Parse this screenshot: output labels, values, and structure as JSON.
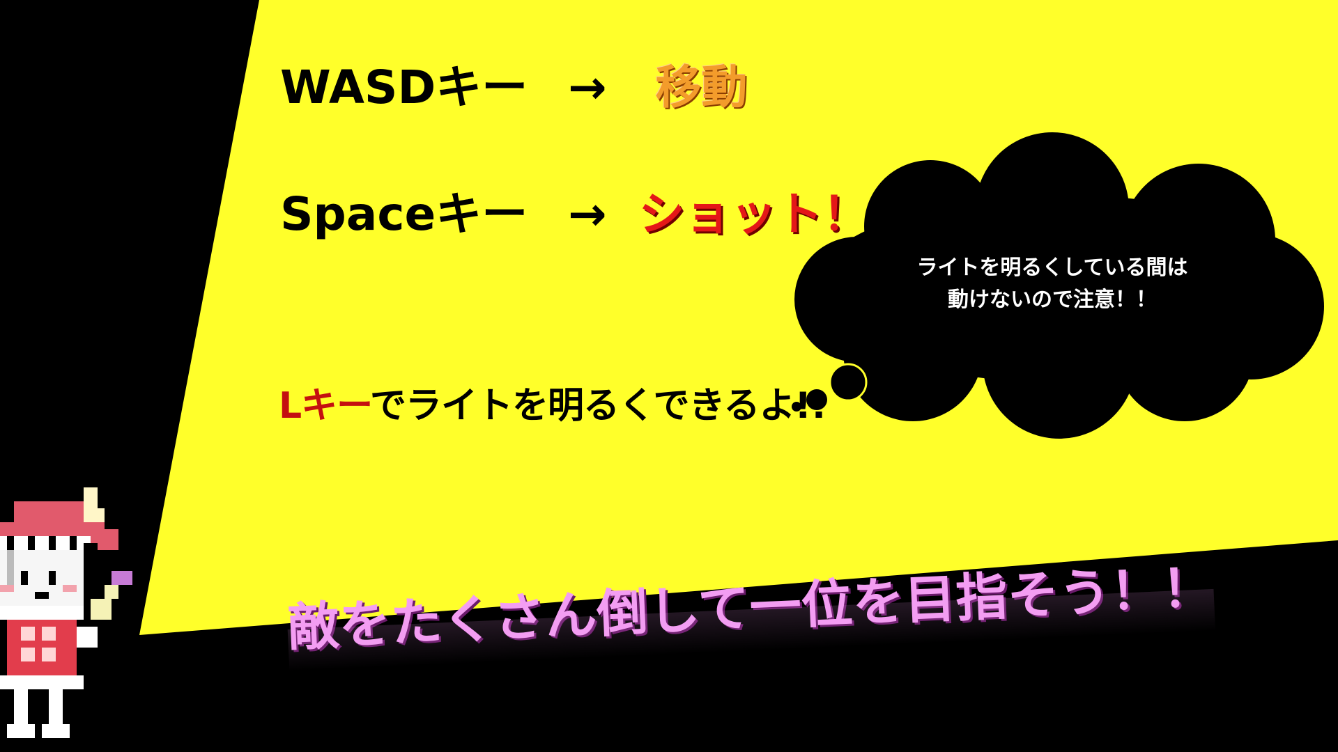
{
  "controls": {
    "move_key": "WASDキー",
    "move_arrow": "→",
    "move_action": "移動",
    "shot_key": "Spaceキー",
    "shot_arrow": "→",
    "shot_action": "ショット！"
  },
  "light_hint": {
    "key": "Lキー",
    "text": "でライトを明るくできるよ!!"
  },
  "cloud": {
    "line1": "ライトを明るくしている間は",
    "line2": "動けないので注意！！"
  },
  "goal_text": "敵をたくさん倒して一位を目指そう！！",
  "colors": {
    "background": "#000000",
    "spotlight": "#ffff2a",
    "move_action": "#f39c2b",
    "shot_action": "#e41818",
    "key_l": "#c41010",
    "goal_text": "#f39df2",
    "cloud": "#000000",
    "cloud_text": "#ffffff"
  },
  "character": {
    "icon": "pixel-shrine-maiden-sprite"
  }
}
